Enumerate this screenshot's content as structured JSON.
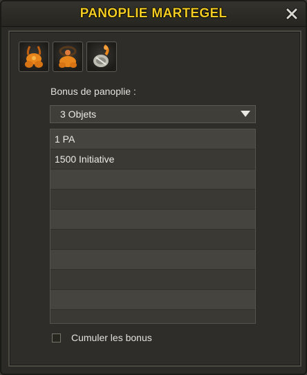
{
  "window": {
    "title": "PANOPLIE MARTEGEL",
    "close_icon": "close-icon"
  },
  "items": [
    {
      "icon": "amulet-item-icon",
      "color": "#e8861c"
    },
    {
      "icon": "ring-item-icon",
      "color": "#e8861c"
    },
    {
      "icon": "hammer-item-icon",
      "color": "#c9c9c1"
    }
  ],
  "bonus": {
    "label": "Bonus de panoplie :",
    "dropdown_value": "3 Objets",
    "rows": [
      "1 PA",
      "1500 Initiative",
      "",
      "",
      "",
      "",
      "",
      "",
      "",
      ""
    ]
  },
  "cumuler": {
    "label": "Cumuler les bonus",
    "checked": false
  },
  "colors": {
    "title": "#f2cb23",
    "background": "#2b2a26"
  }
}
